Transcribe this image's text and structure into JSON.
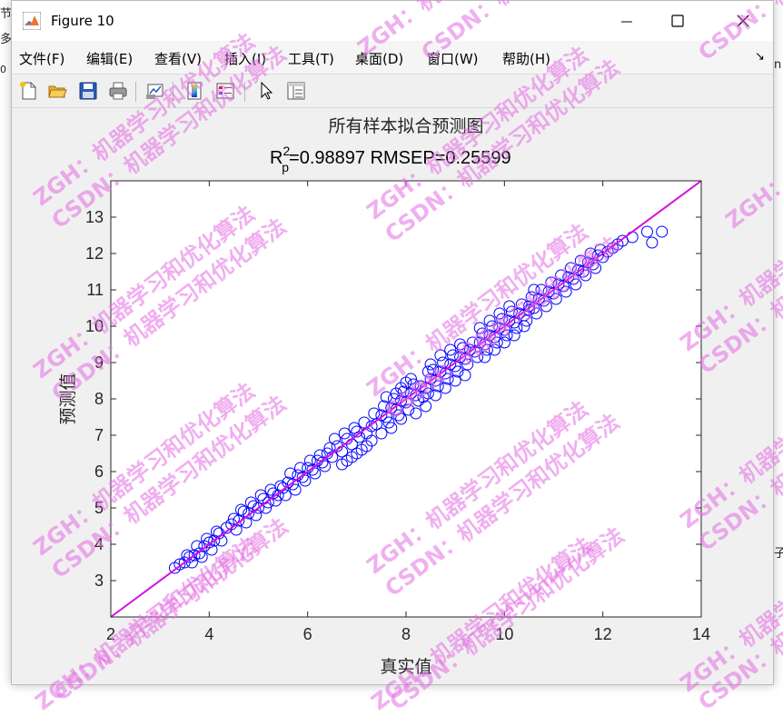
{
  "background": {
    "left_top_char": "节",
    "left_char2": "多",
    "left_char3": "0",
    "right_char": "n",
    "right_char2": "子"
  },
  "window": {
    "title": "Figure 10",
    "buttons": {
      "minimize": "minimize",
      "maximize": "maximize",
      "close": "close"
    }
  },
  "menu": {
    "items": [
      "文件(F)",
      "编辑(E)",
      "查看(V)",
      "插入(I)",
      "工具(T)",
      "桌面(D)",
      "窗口(W)",
      "帮助(H)"
    ],
    "dock_arrow": "↘"
  },
  "toolbar": {
    "icons": [
      "new-figure-icon",
      "open-file-icon",
      "save-icon",
      "print-icon",
      "link-plot-icon",
      "insert-colorbar-icon",
      "insert-legend-icon",
      "edit-plot-arrow-icon",
      "property-inspector-icon"
    ]
  },
  "watermark": {
    "line1": "ZGH：机器学习和优化算法",
    "line2": "CSDN：机器学习和优化算法"
  },
  "chart_data": {
    "type": "scatter",
    "title": "所有样本拟合预测图",
    "subtitle": {
      "r_base": "R",
      "r_sup": "2",
      "r_sub": "p",
      "rest": "=0.98897  RMSEP=0.25599"
    },
    "xlabel": "真实值",
    "ylabel": "预测值",
    "xlim": [
      2,
      14
    ],
    "ylim": [
      2,
      14
    ],
    "xticks": [
      2,
      4,
      6,
      8,
      10,
      12,
      14
    ],
    "yticks": [
      3,
      4,
      5,
      6,
      7,
      8,
      9,
      10,
      11,
      12,
      13
    ],
    "grid": false,
    "marker": "circle",
    "marker_color": "#0000ff",
    "fit_line_color": "#d40fe0",
    "fit_line": {
      "x": [
        2,
        14
      ],
      "y": [
        2,
        14
      ]
    },
    "points": [
      [
        3.3,
        3.35
      ],
      [
        3.4,
        3.45
      ],
      [
        3.5,
        3.5
      ],
      [
        3.6,
        3.65
      ],
      [
        3.7,
        3.7
      ],
      [
        3.8,
        3.75
      ],
      [
        3.9,
        3.95
      ],
      [
        4.0,
        4.05
      ],
      [
        4.1,
        4.1
      ],
      [
        4.2,
        4.3
      ],
      [
        3.55,
        3.7
      ],
      [
        3.75,
        3.95
      ],
      [
        3.95,
        4.15
      ],
      [
        4.15,
        4.35
      ],
      [
        3.65,
        3.5
      ],
      [
        3.85,
        3.65
      ],
      [
        4.05,
        3.85
      ],
      [
        4.25,
        4.1
      ],
      [
        4.35,
        4.45
      ],
      [
        4.45,
        4.55
      ],
      [
        4.5,
        4.7
      ],
      [
        4.6,
        4.65
      ],
      [
        4.7,
        4.9
      ],
      [
        4.8,
        4.85
      ],
      [
        4.9,
        5.05
      ],
      [
        5.0,
        5.0
      ],
      [
        5.1,
        5.25
      ],
      [
        5.2,
        5.15
      ],
      [
        5.3,
        5.4
      ],
      [
        5.4,
        5.35
      ],
      [
        4.55,
        4.4
      ],
      [
        4.75,
        4.6
      ],
      [
        4.95,
        4.8
      ],
      [
        5.15,
        5.0
      ],
      [
        5.35,
        5.2
      ],
      [
        4.65,
        4.95
      ],
      [
        4.85,
        5.15
      ],
      [
        5.05,
        5.35
      ],
      [
        5.25,
        5.5
      ],
      [
        5.45,
        5.6
      ],
      [
        5.5,
        5.55
      ],
      [
        5.6,
        5.7
      ],
      [
        5.7,
        5.65
      ],
      [
        5.8,
        5.9
      ],
      [
        5.9,
        5.85
      ],
      [
        6.0,
        6.1
      ],
      [
        6.1,
        6.05
      ],
      [
        6.2,
        6.3
      ],
      [
        6.3,
        6.25
      ],
      [
        6.4,
        6.5
      ],
      [
        5.55,
        5.35
      ],
      [
        5.75,
        5.5
      ],
      [
        5.95,
        5.75
      ],
      [
        6.15,
        5.95
      ],
      [
        6.35,
        6.15
      ],
      [
        5.65,
        5.95
      ],
      [
        5.85,
        6.1
      ],
      [
        6.05,
        6.3
      ],
      [
        6.25,
        6.45
      ],
      [
        6.45,
        6.65
      ],
      [
        6.5,
        6.4
      ],
      [
        6.6,
        6.7
      ],
      [
        6.7,
        6.55
      ],
      [
        6.8,
        6.9
      ],
      [
        6.9,
        6.75
      ],
      [
        7.0,
        7.1
      ],
      [
        6.55,
        6.9
      ],
      [
        6.75,
        7.05
      ],
      [
        6.95,
        7.2
      ],
      [
        7.15,
        7.35
      ],
      [
        6.8,
        6.3
      ],
      [
        6.9,
        6.4
      ],
      [
        7.0,
        6.5
      ],
      [
        7.1,
        6.6
      ],
      [
        7.2,
        6.7
      ],
      [
        6.7,
        6.2
      ],
      [
        7.3,
        6.85
      ],
      [
        7.05,
        6.95
      ],
      [
        7.2,
        7.05
      ],
      [
        7.3,
        7.25
      ],
      [
        7.4,
        7.3
      ],
      [
        7.5,
        7.55
      ],
      [
        7.6,
        7.5
      ],
      [
        7.7,
        7.75
      ],
      [
        7.8,
        7.7
      ],
      [
        7.9,
        7.95
      ],
      [
        8.0,
        7.9
      ],
      [
        8.1,
        8.15
      ],
      [
        8.2,
        8.1
      ],
      [
        8.3,
        8.35
      ],
      [
        7.35,
        7.6
      ],
      [
        7.55,
        7.8
      ],
      [
        7.75,
        8.0
      ],
      [
        7.95,
        8.2
      ],
      [
        8.15,
        8.4
      ],
      [
        7.65,
        7.35
      ],
      [
        7.85,
        7.55
      ],
      [
        8.05,
        7.7
      ],
      [
        8.25,
        7.95
      ],
      [
        8.45,
        8.15
      ],
      [
        7.6,
        8.05
      ],
      [
        7.8,
        8.15
      ],
      [
        7.9,
        8.3
      ],
      [
        8.0,
        8.45
      ],
      [
        8.1,
        8.55
      ],
      [
        7.5,
        7.05
      ],
      [
        7.7,
        7.2
      ],
      [
        7.9,
        7.45
      ],
      [
        8.2,
        7.6
      ],
      [
        8.4,
        7.8
      ],
      [
        8.4,
        8.3
      ],
      [
        8.5,
        8.55
      ],
      [
        8.6,
        8.5
      ],
      [
        8.7,
        8.75
      ],
      [
        8.8,
        8.7
      ],
      [
        8.9,
        8.95
      ],
      [
        9.0,
        8.9
      ],
      [
        9.1,
        9.15
      ],
      [
        9.2,
        9.1
      ],
      [
        9.3,
        9.35
      ],
      [
        8.55,
        8.8
      ],
      [
        8.75,
        9.0
      ],
      [
        8.95,
        9.2
      ],
      [
        9.15,
        9.4
      ],
      [
        9.35,
        9.55
      ],
      [
        8.65,
        8.35
      ],
      [
        8.85,
        8.55
      ],
      [
        9.05,
        8.75
      ],
      [
        9.25,
        8.95
      ],
      [
        9.45,
        9.15
      ],
      [
        8.5,
        8.95
      ],
      [
        8.7,
        9.2
      ],
      [
        8.9,
        9.35
      ],
      [
        9.1,
        9.5
      ],
      [
        8.6,
        8.1
      ],
      [
        8.8,
        8.3
      ],
      [
        9.0,
        8.5
      ],
      [
        9.2,
        8.65
      ],
      [
        8.45,
        8.75
      ],
      [
        8.35,
        8.05
      ],
      [
        9.4,
        9.3
      ],
      [
        9.5,
        9.55
      ],
      [
        9.6,
        9.5
      ],
      [
        9.7,
        9.75
      ],
      [
        9.8,
        9.7
      ],
      [
        9.9,
        9.95
      ],
      [
        10.0,
        9.9
      ],
      [
        10.1,
        10.15
      ],
      [
        10.2,
        10.1
      ],
      [
        10.3,
        10.35
      ],
      [
        9.55,
        9.8
      ],
      [
        9.75,
        10.0
      ],
      [
        9.95,
        10.2
      ],
      [
        10.15,
        10.4
      ],
      [
        10.35,
        10.6
      ],
      [
        9.65,
        9.35
      ],
      [
        9.85,
        9.55
      ],
      [
        10.05,
        9.75
      ],
      [
        10.25,
        9.95
      ],
      [
        10.45,
        10.15
      ],
      [
        9.5,
        9.95
      ],
      [
        9.7,
        10.15
      ],
      [
        9.9,
        10.35
      ],
      [
        10.1,
        10.55
      ],
      [
        9.6,
        9.15
      ],
      [
        9.8,
        9.35
      ],
      [
        10.0,
        9.55
      ],
      [
        10.2,
        9.75
      ],
      [
        10.4,
        10.0
      ],
      [
        10.5,
        10.45
      ],
      [
        10.4,
        10.3
      ],
      [
        10.5,
        10.55
      ],
      [
        10.6,
        10.5
      ],
      [
        10.7,
        10.75
      ],
      [
        10.8,
        10.7
      ],
      [
        10.9,
        10.95
      ],
      [
        11.0,
        10.9
      ],
      [
        11.1,
        11.15
      ],
      [
        11.2,
        11.1
      ],
      [
        11.3,
        11.35
      ],
      [
        10.55,
        10.8
      ],
      [
        10.75,
        11.0
      ],
      [
        10.95,
        11.2
      ],
      [
        11.15,
        11.4
      ],
      [
        10.65,
        10.35
      ],
      [
        10.85,
        10.55
      ],
      [
        11.05,
        10.75
      ],
      [
        11.25,
        10.95
      ],
      [
        11.45,
        11.15
      ],
      [
        10.6,
        11.0
      ],
      [
        11.4,
        11.3
      ],
      [
        11.5,
        11.55
      ],
      [
        11.6,
        11.5
      ],
      [
        11.7,
        11.75
      ],
      [
        11.8,
        11.7
      ],
      [
        11.9,
        11.95
      ],
      [
        12.0,
        11.9
      ],
      [
        11.55,
        11.8
      ],
      [
        11.75,
        12.0
      ],
      [
        11.95,
        12.1
      ],
      [
        11.35,
        11.6
      ],
      [
        11.65,
        11.4
      ],
      [
        11.85,
        11.6
      ],
      [
        12.1,
        12.05
      ],
      [
        12.2,
        12.15
      ],
      [
        12.3,
        12.25
      ],
      [
        12.4,
        12.35
      ],
      [
        12.6,
        12.45
      ],
      [
        12.9,
        12.6
      ],
      [
        13.0,
        12.3
      ],
      [
        13.2,
        12.6
      ]
    ]
  }
}
